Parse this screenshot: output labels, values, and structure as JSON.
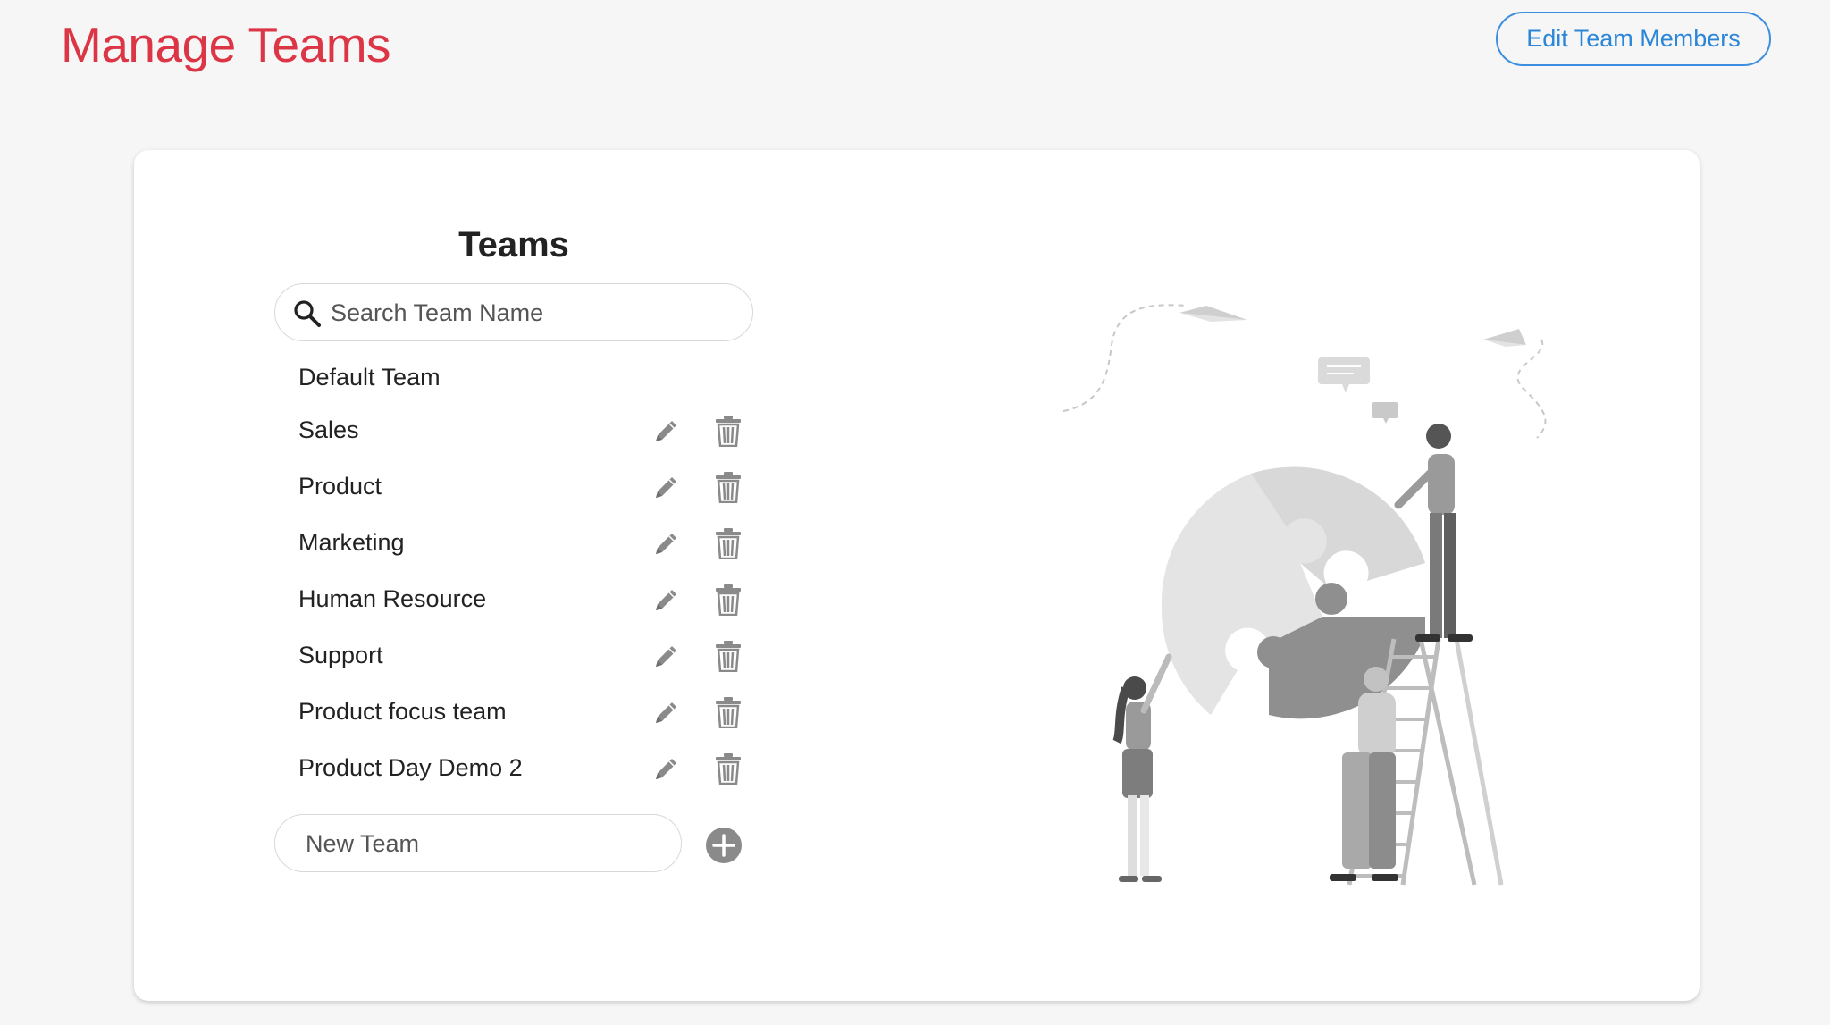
{
  "header": {
    "title": "Manage Teams",
    "edit_members_label": "Edit Team Members"
  },
  "teams_panel": {
    "heading": "Teams",
    "search_placeholder": "Search Team Name",
    "teams": [
      {
        "name": "Default Team",
        "editable": false
      },
      {
        "name": "Sales",
        "editable": true
      },
      {
        "name": "Product",
        "editable": true
      },
      {
        "name": "Marketing",
        "editable": true
      },
      {
        "name": "Human Resource",
        "editable": true
      },
      {
        "name": "Support",
        "editable": true
      },
      {
        "name": "Product focus team",
        "editable": true
      },
      {
        "name": "Product Day Demo 2",
        "editable": true
      }
    ],
    "new_team_placeholder": "New Team"
  },
  "icons": {
    "search": "search-icon",
    "edit": "pencil-icon",
    "delete": "trash-icon",
    "add": "plus-circle-icon"
  },
  "colors": {
    "title": "#dc3545",
    "accent": "#2b86d8",
    "icon_gray": "#8a8a8a",
    "background": "#f6f6f6"
  }
}
